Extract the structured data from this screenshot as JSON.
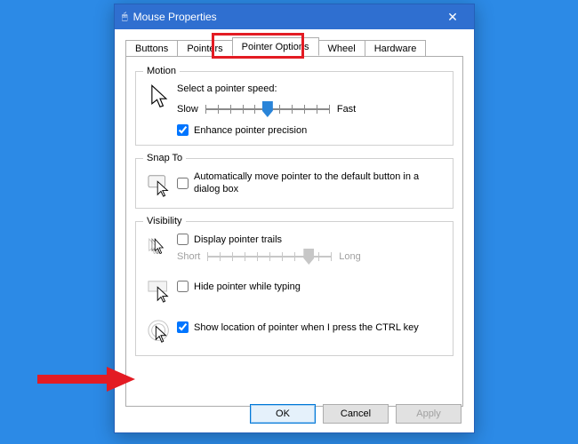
{
  "window": {
    "title": "Mouse Properties"
  },
  "tabs": {
    "t0": "Buttons",
    "t1": "Pointers",
    "t2": "Pointer Options",
    "t3": "Wheel",
    "t4": "Hardware",
    "active_index": 2
  },
  "motion": {
    "legend": "Motion",
    "label": "Select a pointer speed:",
    "slow": "Slow",
    "fast": "Fast",
    "slider": {
      "min": 0,
      "max": 10,
      "value": 5
    },
    "enhance": {
      "label": "Enhance pointer precision",
      "checked": true
    }
  },
  "snapto": {
    "legend": "Snap To",
    "auto": {
      "label": "Automatically move pointer to the default button in a dialog box",
      "checked": false
    }
  },
  "visibility": {
    "legend": "Visibility",
    "trails": {
      "label": "Display pointer trails",
      "checked": false,
      "short": "Short",
      "long": "Long",
      "slider": {
        "min": 0,
        "max": 10,
        "value": 8,
        "disabled": true
      }
    },
    "hide": {
      "label": "Hide pointer while typing",
      "checked": false
    },
    "ctrl": {
      "label": "Show location of pointer when I press the CTRL key",
      "checked": true
    }
  },
  "buttons": {
    "ok": "OK",
    "cancel": "Cancel",
    "apply": "Apply"
  }
}
